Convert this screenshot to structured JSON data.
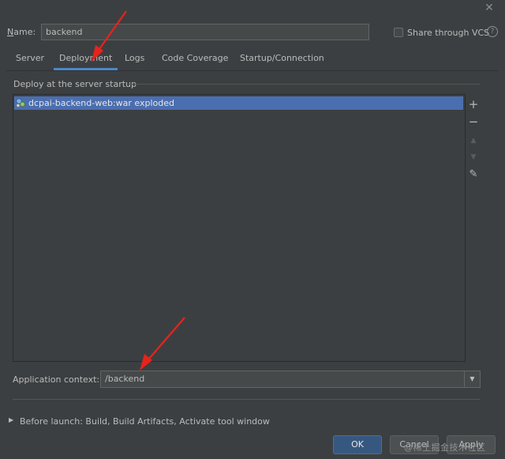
{
  "window": {
    "close_glyph": "✕"
  },
  "name_row": {
    "label_prefix": "N",
    "label_rest": "ame:",
    "value": "backend",
    "share_label": "Share through VCS",
    "help_glyph": "?"
  },
  "tabs": [
    {
      "label": "Server",
      "active": false
    },
    {
      "label": "Deployment",
      "active": true
    },
    {
      "label": "Logs",
      "active": false
    },
    {
      "label": "Code Coverage",
      "active": false
    },
    {
      "label": "Startup/Connection",
      "active": false
    }
  ],
  "deploy_section": {
    "title": "Deploy at the server startup",
    "items": [
      {
        "label": "dcpai-backend-web:war exploded",
        "icon": "artifact-icon",
        "selected": true
      }
    ],
    "toolbar": [
      {
        "name": "add-icon",
        "glyph": "+",
        "enabled": true
      },
      {
        "name": "remove-icon",
        "glyph": "−",
        "enabled": true
      },
      {
        "name": "move-up-icon",
        "glyph": "▲",
        "enabled": false
      },
      {
        "name": "move-down-icon",
        "glyph": "▼",
        "enabled": false
      },
      {
        "name": "edit-icon",
        "glyph": "✎",
        "enabled": true
      }
    ]
  },
  "app_context": {
    "label": "Application context:",
    "value": "/backend",
    "dropdown_glyph": "▼"
  },
  "before_launch": {
    "arrow_glyph": "▶",
    "label": "Before launch: Build, Build Artifacts, Activate tool window"
  },
  "buttons": {
    "ok": "OK",
    "cancel": "Cancel",
    "apply": "Apply"
  },
  "watermark": "@稀土掘金技术社区",
  "colors": {
    "background": "#3c3f41",
    "selection": "#4b6eaf",
    "tab_underline": "#4a88c7",
    "ok_button": "#365880",
    "annotation_arrow": "#e8231c"
  }
}
